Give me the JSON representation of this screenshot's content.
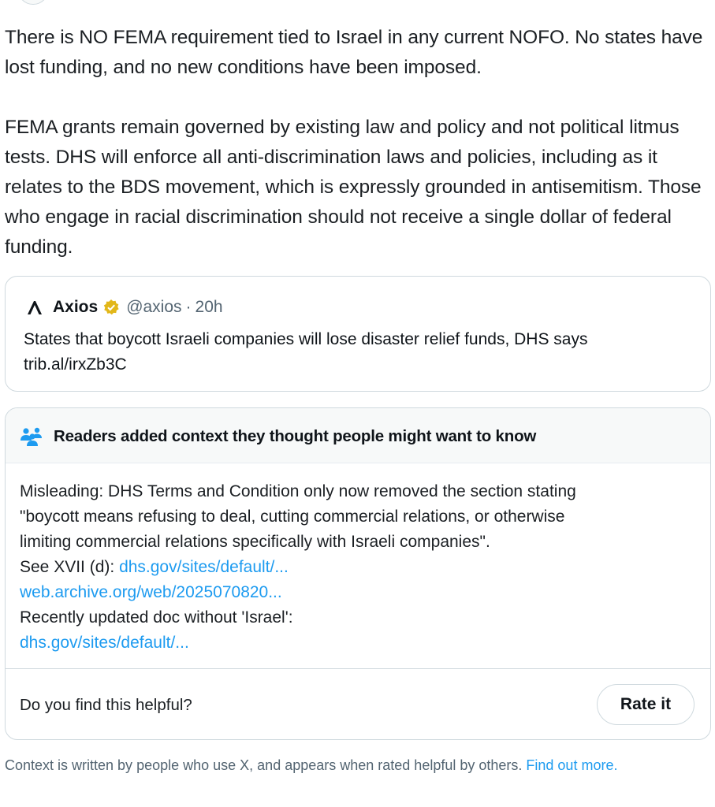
{
  "tweet": {
    "paragraphs": [
      "There is NO FEMA requirement tied to Israel in any current NOFO. No states have lost funding, and no new conditions have been imposed.",
      "FEMA grants remain governed by existing law and policy and not political litmus tests. DHS will enforce all anti-discrimination laws and policies, including as it relates to the BDS movement, which is expressly grounded in antisemitism. Those who engage in racial discrimination should not receive a single dollar of federal funding."
    ]
  },
  "quote": {
    "logo_icon": "axios-logo-icon",
    "name": "Axios",
    "verified_icon": "verified-badge-icon",
    "verified_color": "#e2b719",
    "handle": "@axios",
    "separator": "·",
    "time": "20h",
    "text_line1": "States that boycott Israeli companies will lose disaster relief funds, DHS says",
    "link": "trib.al/irxZb3C"
  },
  "community_note": {
    "header_icon": "people-icon",
    "header_icon_color": "#1d9bf0",
    "title": "Readers added context they thought people might want to know",
    "body_line1": "Misleading: DHS Terms and Condition only now removed the section stating",
    "body_line2": "\"boycott means refusing to deal, cutting commercial relations, or otherwise",
    "body_line3": "limiting commercial relations specifically with Israeli companies\".",
    "see_prefix": "See XVII (d): ",
    "link1": "dhs.gov/sites/default/...",
    "link2": "web.archive.org/web/2025070820...",
    "updated_text": "Recently updated doc without 'Israel':",
    "link3": "dhs.gov/sites/default/...",
    "helpful_question": "Do you find this helpful?",
    "rate_button": "Rate it"
  },
  "footer": {
    "text": "Context is written by people who use X, and appears when rated helpful by others. ",
    "link": "Find out more."
  },
  "colors": {
    "link": "#1d9bf0",
    "secondary_text": "#536471",
    "border": "#cfd9de",
    "header_bg": "#f7f9f9"
  }
}
